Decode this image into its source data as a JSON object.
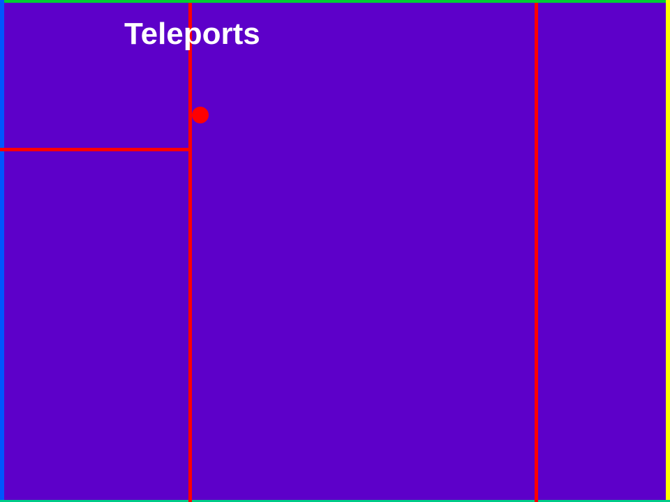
{
  "game": {
    "level_title": "Teleports"
  },
  "colors": {
    "background": "#5d00c9",
    "wall": "#ff0000",
    "player": "#ff0000",
    "title": "#ffffff",
    "border_top": "#00cc33",
    "border_left": "#0055ff",
    "border_right": "#ffff00",
    "border_bottom": "#00cc88"
  }
}
